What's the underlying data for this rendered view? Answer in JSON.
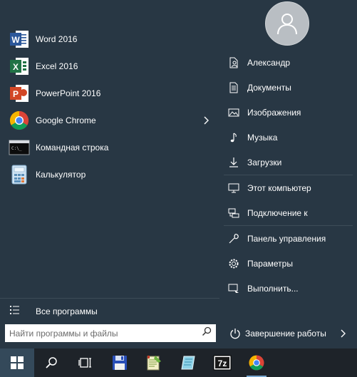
{
  "apps": [
    {
      "label": "Word 2016",
      "icon": "word-icon"
    },
    {
      "label": "Excel 2016",
      "icon": "excel-icon"
    },
    {
      "label": "PowerPoint 2016",
      "icon": "powerpoint-icon"
    },
    {
      "label": "Google Chrome",
      "icon": "chrome-icon"
    },
    {
      "label": "Командная строка",
      "icon": "cmd-icon"
    },
    {
      "label": "Калькулятор",
      "icon": "calculator-icon"
    }
  ],
  "all_programs": "Все программы",
  "search": {
    "placeholder": "Найти программы и файлы",
    "value": ""
  },
  "places": {
    "user": "Александр",
    "documents": "Документы",
    "pictures": "Изображения",
    "music": "Музыка",
    "downloads": "Загрузки",
    "computer": "Этот компьютер",
    "connect": "Подключение к",
    "control_panel": "Панель управления",
    "settings": "Параметры",
    "run": "Выполнить..."
  },
  "power": {
    "label": "Завершение работы"
  },
  "taskbar": {
    "items": [
      "start-icon",
      "search-icon",
      "task-view-icon",
      "save-disk-icon",
      "notepad-icon",
      "app-icon",
      "7zip-icon",
      "chrome-icon"
    ],
    "sevenzip_label": "7z"
  },
  "colors": {
    "menu_bg": "#283744",
    "taskbar_bg": "#1e2329",
    "accent": "#78a7cf"
  }
}
